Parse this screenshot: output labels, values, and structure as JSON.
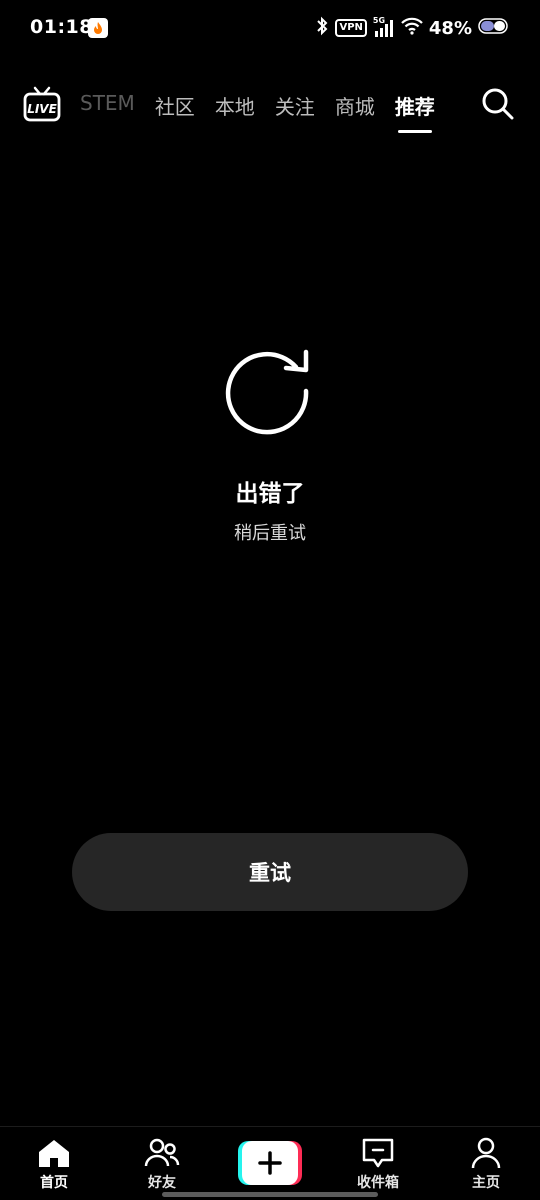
{
  "status_bar": {
    "time": "01:18",
    "vpn": "VPN",
    "network": "5G",
    "battery": "48%",
    "icons": [
      "app-notification-icon",
      "bluetooth-icon",
      "signal-icon",
      "wifi-icon",
      "battery-icon"
    ]
  },
  "top_nav": {
    "live_icon": "live-tv-icon",
    "tabs": [
      {
        "label": "STEM"
      },
      {
        "label": "社区"
      },
      {
        "label": "本地"
      },
      {
        "label": "关注"
      },
      {
        "label": "商城"
      },
      {
        "label": "推荐"
      }
    ],
    "active_tab": "推荐",
    "search_icon": "search-icon"
  },
  "error_state": {
    "icon": "refresh-icon",
    "title": "出错了",
    "subtitle": "稍后重试",
    "retry_label": "重试"
  },
  "bottom_nav": {
    "items": [
      {
        "label": "首页",
        "icon": "home-icon"
      },
      {
        "label": "好友",
        "icon": "friends-icon"
      },
      {
        "label": "",
        "icon": "plus-icon"
      },
      {
        "label": "收件箱",
        "icon": "inbox-icon"
      },
      {
        "label": "主页",
        "icon": "profile-icon"
      }
    ]
  },
  "colors": {
    "background": "#000000",
    "button_bg": "#262626",
    "create_left": "#25F4EE",
    "create_right": "#FE2C55"
  }
}
